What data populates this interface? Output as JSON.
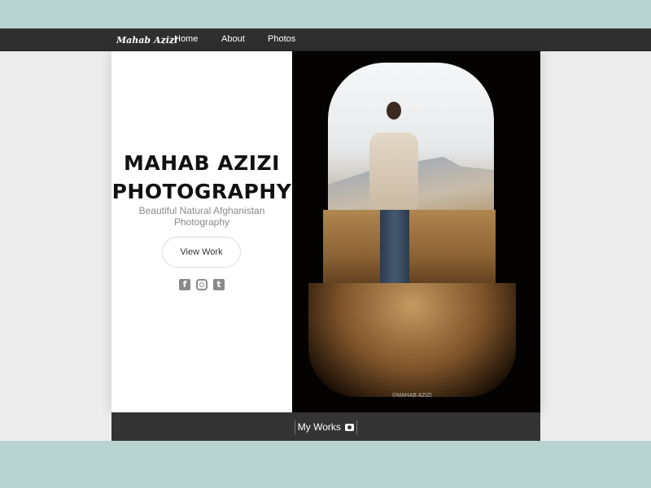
{
  "nav": {
    "brand": "Mahab Azizi",
    "links": [
      "Home",
      "About",
      "Photos"
    ]
  },
  "hero": {
    "title": "MAHAB AZIZI PHOTOGRAPHY",
    "subtitle": "Beautiful Natural Afghanistan Photography",
    "button": "View Work",
    "social": [
      "facebook-icon",
      "instagram-icon",
      "twitter-icon"
    ],
    "watermark": "©MAHAB AZIZI"
  },
  "footer": {
    "label": "My Works",
    "icon": "camera-icon"
  }
}
